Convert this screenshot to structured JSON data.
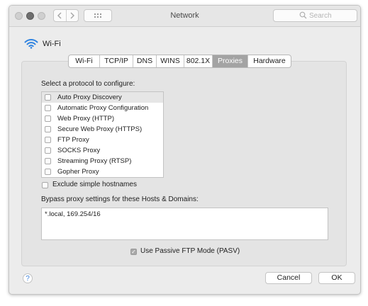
{
  "window": {
    "title": "Network"
  },
  "search": {
    "placeholder": "Search"
  },
  "interface": {
    "name": "Wi-Fi"
  },
  "tabs": [
    {
      "label": "Wi-Fi",
      "active": false
    },
    {
      "label": "TCP/IP",
      "active": false
    },
    {
      "label": "DNS",
      "active": false
    },
    {
      "label": "WINS",
      "active": false
    },
    {
      "label": "802.1X",
      "active": false
    },
    {
      "label": "Proxies",
      "active": true
    },
    {
      "label": "Hardware",
      "active": false
    }
  ],
  "proxies": {
    "select_label": "Select a protocol to configure:",
    "protocols": [
      {
        "label": "Auto Proxy Discovery",
        "checked": false,
        "selected": true
      },
      {
        "label": "Automatic Proxy Configuration",
        "checked": false,
        "selected": false
      },
      {
        "label": "Web Proxy (HTTP)",
        "checked": false,
        "selected": false
      },
      {
        "label": "Secure Web Proxy (HTTPS)",
        "checked": false,
        "selected": false
      },
      {
        "label": "FTP Proxy",
        "checked": false,
        "selected": false
      },
      {
        "label": "SOCKS Proxy",
        "checked": false,
        "selected": false
      },
      {
        "label": "Streaming Proxy (RTSP)",
        "checked": false,
        "selected": false
      },
      {
        "label": "Gopher Proxy",
        "checked": false,
        "selected": false
      }
    ],
    "exclude_simple_hostnames": {
      "label": "Exclude simple hostnames",
      "checked": false
    },
    "bypass_label": "Bypass proxy settings for these Hosts & Domains:",
    "bypass_value": "*.local, 169.254/16",
    "passive_ftp": {
      "label": "Use Passive FTP Mode (PASV)",
      "checked": true,
      "checkmark": "✓"
    }
  },
  "footer": {
    "help_label": "?",
    "cancel_label": "Cancel",
    "ok_label": "OK"
  },
  "colors": {
    "active_tab": "#a3a3a3",
    "help_accent": "#3a7fd9",
    "panel_bg": "#e4e4e4"
  }
}
